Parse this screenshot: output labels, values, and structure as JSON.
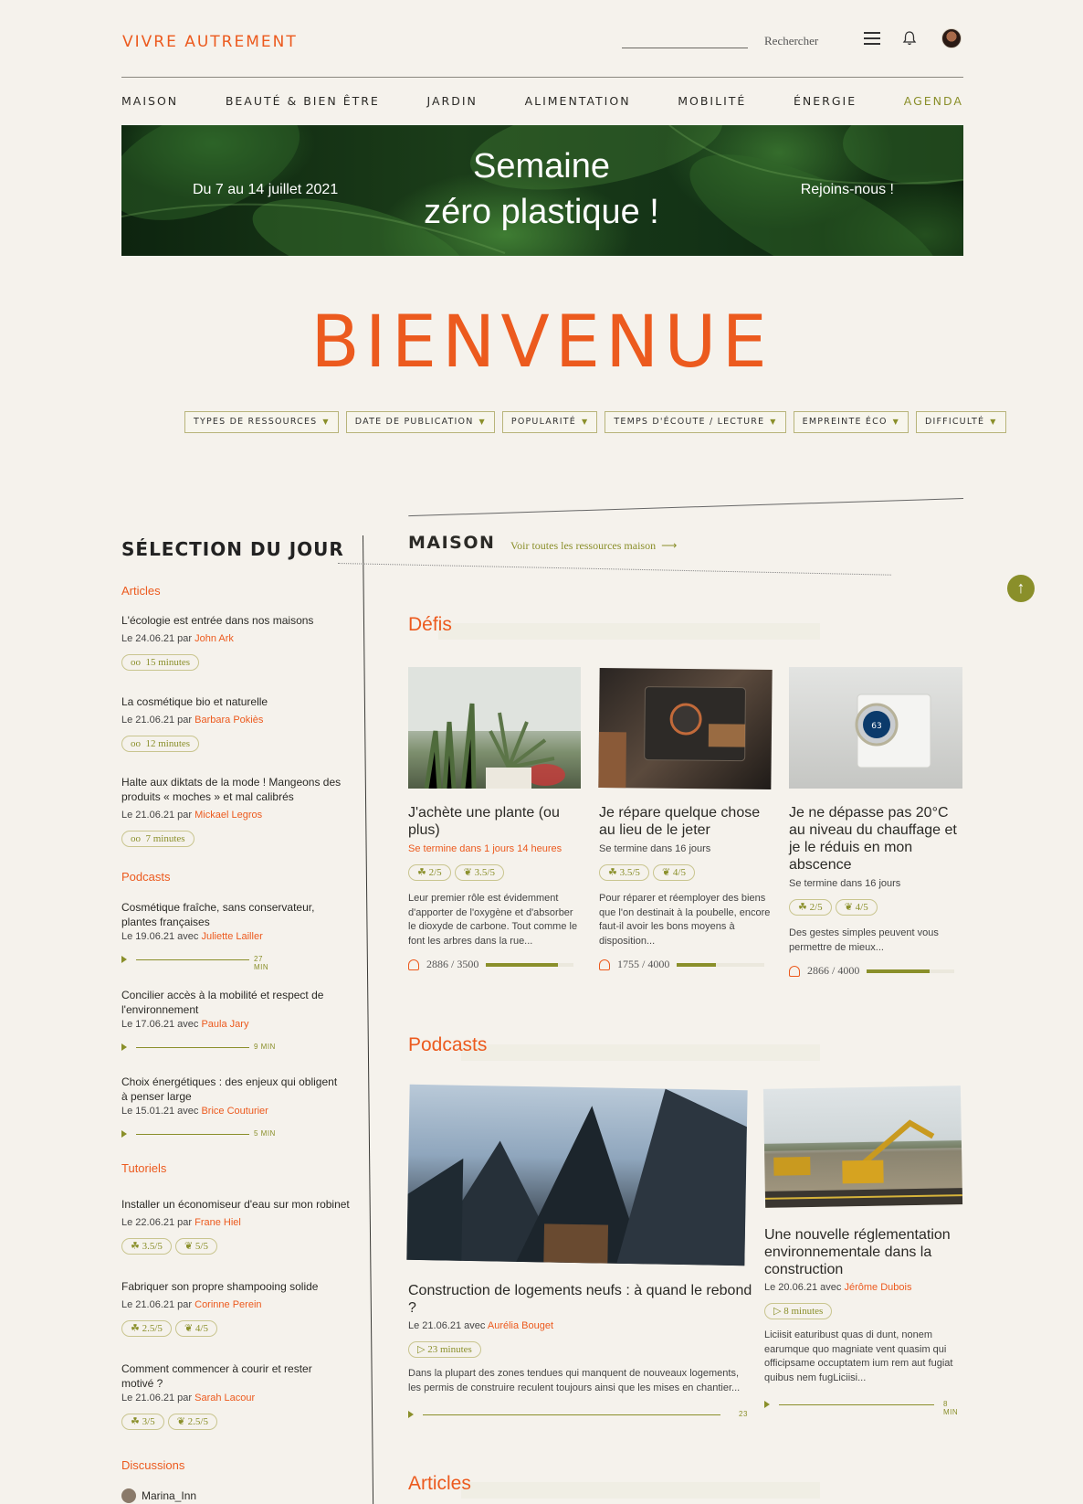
{
  "header": {
    "brand": "VIVRE AUTREMENT",
    "search_label": "Rechercher",
    "search_placeholder": ""
  },
  "nav": [
    "MAISON",
    "BEAUTÉ & BIEN ÊTRE",
    "JARDIN",
    "ALIMENTATION",
    "MOBILITÉ",
    "ÉNERGIE",
    "AGENDA"
  ],
  "banner": {
    "left": "Du 7 au 14 juillet 2021",
    "title_line1": "Semaine",
    "title_line2": "zéro plastique !",
    "right": "Rejoins-nous !"
  },
  "hero": "BIENVENUE",
  "filters": [
    "TYPES DE RESSOURCES",
    "DATE DE PUBLICATION",
    "POPULARITÉ",
    "TEMPS D'ÉCOUTE / LECTURE",
    "EMPREINTE ÉCO",
    "DIFFICULTÉ"
  ],
  "selection": {
    "title": "SÉLECTION DU JOUR",
    "articles_label": "Articles",
    "articles": [
      {
        "title": "L'écologie est entrée dans nos maisons",
        "meta": "Le 24.06.21 par ",
        "author": "John Ark",
        "time": "15 minutes"
      },
      {
        "title": "La cosmétique bio et naturelle",
        "meta": "Le 21.06.21 par ",
        "author": "Barbara Pokiès",
        "time": "12 minutes"
      },
      {
        "title": "Halte aux diktats de la mode ! Mangeons des produits « moches » et mal calibrés",
        "meta": "Le 21.06.21 par ",
        "author": "Mickael Legros",
        "time": "7 minutes"
      }
    ],
    "podcasts_label": "Podcasts",
    "podcasts": [
      {
        "title": "Cosmétique fraîche, sans conservateur, plantes françaises",
        "meta": "Le 19.06.21 avec ",
        "author": "Juliette Lailler",
        "dur": "27 MIN"
      },
      {
        "title": "Concilier accès à la mobilité et respect de l'environnement",
        "meta": "Le 17.06.21 avec ",
        "author": "Paula Jary",
        "dur": "9 MIN"
      },
      {
        "title": "Choix énergétiques : des enjeux qui obligent à penser large",
        "meta": "Le 15.01.21 avec ",
        "author": "Brice Couturier",
        "dur": "5 MIN"
      }
    ],
    "tutorials_label": "Tutoriels",
    "tutorials": [
      {
        "title": "Installer un économiseur d'eau sur mon robinet",
        "meta": "Le 22.06.21 par ",
        "author": "Frane Hiel",
        "a": "3.5/5",
        "b": "5/5"
      },
      {
        "title": "Fabriquer son propre shampooing solide",
        "meta": "Le 21.06.21 par ",
        "author": "Corinne Perein",
        "a": "2.5/5",
        "b": "4/5"
      },
      {
        "title": "Comment commencer à courir et rester motivé ?",
        "meta": "Le 21.06.21 par ",
        "author": "Sarah Lacour",
        "a": "3/5",
        "b": "2.5/5"
      }
    ],
    "discussions_label": "Discussions",
    "discussion_user": "Marina_Inn"
  },
  "maison": {
    "title": "MAISON",
    "link": "Voir toutes les ressources maison",
    "defis_label": "Défis",
    "defis": [
      {
        "title": "J'achète une plante (ou plus)",
        "meta": "Se termine dans 1 jours 14 heures",
        "a": "2/5",
        "b": "3.5/5",
        "desc": "Leur premier rôle est évidemment d'apporter de l'oxygène et d'absorber le dioxyde de carbone. Tout comme le font les arbres dans la rue...",
        "count": "2886 / 3500",
        "progress": 0.82
      },
      {
        "title": "Je répare quelque chose au lieu de le jeter",
        "meta": "Se termine dans 16 jours",
        "a": "3.5/5",
        "b": "4/5",
        "desc": "Pour réparer et réemployer des biens que l'on destinait à la poubelle, encore faut-il avoir les bons moyens à disposition...",
        "count": "1755 / 4000",
        "progress": 0.44
      },
      {
        "title": "Je ne dépasse pas 20°C au niveau du chauffage et je le réduis en mon abscence",
        "meta": "Se termine dans 16 jours",
        "a": "2/5",
        "b": "4/5",
        "desc": "Des gestes simples peuvent vous permettre de mieux...",
        "count": "2866 / 4000",
        "progress": 0.72
      }
    ],
    "podcasts_label": "Podcasts",
    "podcasts": [
      {
        "title": "Construction de logements neufs : à quand le rebond ?",
        "meta": "Le 21.06.21 avec ",
        "author": "Aurélia Bouget",
        "time": "23 minutes",
        "desc": "Dans la plupart des zones tendues qui manquent de nouveaux logements, les permis de construire reculent toujours ainsi que les mises en chantier...",
        "dur": "23"
      },
      {
        "title": "Une nouvelle réglementation environnementale dans la construction",
        "meta": "Le 20.06.21 avec ",
        "author": "Jérôme Dubois",
        "time": "8 minutes",
        "desc": "Liciisit eaturibust quas di dunt, nonem earumque quo magniate vent quasim qui officipsame occuptatem ium rem aut fugiat quibus nem fugLiciisi...",
        "dur": "8 MIN"
      }
    ],
    "articles_label": "Articles"
  },
  "colors": {
    "accent": "#ec5a1e",
    "olive": "#8a8f2a",
    "background": "#f5f2ec"
  }
}
